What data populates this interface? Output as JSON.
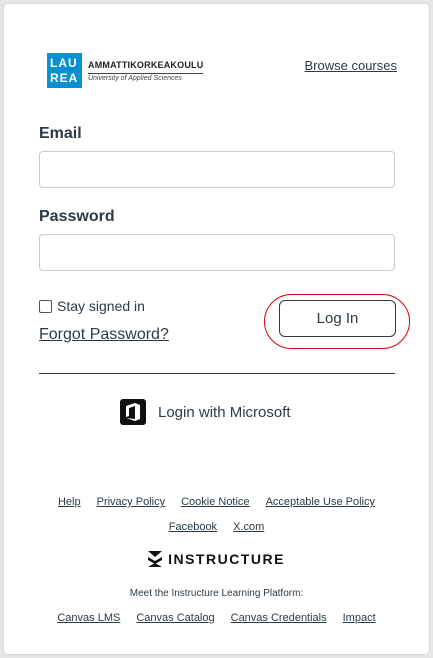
{
  "header": {
    "logo_box_line1": "LAU",
    "logo_box_line2": "REA",
    "logo_name": "AMMATTIKORKEAKOULU",
    "logo_sub": "University of Applied Sciences",
    "browse_link": "Browse courses"
  },
  "form": {
    "email_label": "Email",
    "email_value": "",
    "password_label": "Password",
    "password_value": "",
    "stay_signed_in": "Stay signed in",
    "stay_checked": false,
    "forgot": "Forgot Password?",
    "login_button": "Log In"
  },
  "sso": {
    "microsoft": "Login with Microsoft"
  },
  "footer": {
    "links_row1": [
      "Help",
      "Privacy Policy",
      "Cookie Notice",
      "Acceptable Use Policy"
    ],
    "links_row2": [
      "Facebook",
      "X.com"
    ],
    "brand": "INSTRUCTURE",
    "meet": "Meet the Instructure Learning Platform:",
    "links_row3": [
      "Canvas LMS",
      "Canvas Catalog",
      "Canvas Credentials",
      "Impact"
    ]
  },
  "colors": {
    "highlight_ring": "#d8000c",
    "logo_blue": "#0a8fd0",
    "text": "#2d3b45"
  }
}
